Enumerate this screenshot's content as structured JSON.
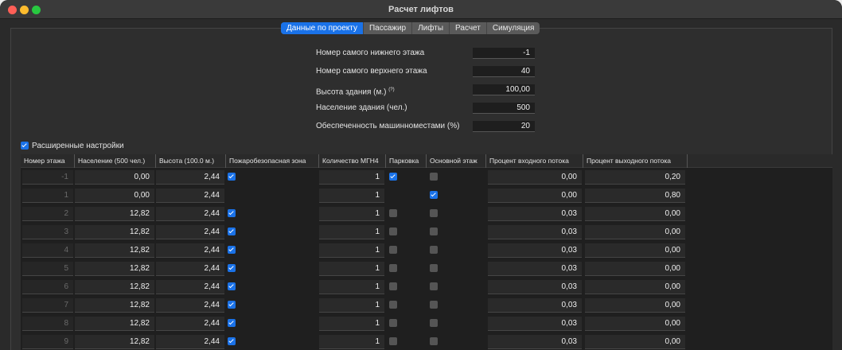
{
  "window": {
    "title": "Расчет лифтов"
  },
  "tabs": [
    {
      "label": "Данные по проекту",
      "active": true
    },
    {
      "label": "Пассажир",
      "active": false
    },
    {
      "label": "Лифты",
      "active": false
    },
    {
      "label": "Расчет",
      "active": false
    },
    {
      "label": "Симуляция",
      "active": false
    }
  ],
  "form": [
    {
      "label": "Номер самого нижнего этажа",
      "value": "-1"
    },
    {
      "label": "Номер самого верхнего этажа",
      "value": "40"
    },
    {
      "label": "Высота здания (м.)",
      "note": "(?)",
      "value": "100,00"
    },
    {
      "label": "Население здания (чел.)",
      "value": "500"
    },
    {
      "label": "Обеспеченность машинноместами (%)",
      "value": "20"
    }
  ],
  "advanced": {
    "label": "Расширенные настройки",
    "checked": true
  },
  "table": {
    "columns": [
      "Номер этажа",
      "Население (500 чел.)",
      "Высота (100.0 м.)",
      "Пожаробезопасная зона",
      "Количество МГН4",
      "Парковка",
      "Основной этаж",
      "Процент входного потока",
      "Процент выходного потока"
    ],
    "rows": [
      {
        "floor": "-1",
        "population": "0,00",
        "height": "2,44",
        "fire": true,
        "mgn": "1",
        "parking": true,
        "main": false,
        "in": "0,00",
        "out": "0,20"
      },
      {
        "floor": "1",
        "population": "0,00",
        "height": "2,44",
        "fire": null,
        "mgn": "1",
        "parking": null,
        "main": true,
        "in": "0,00",
        "out": "0,80"
      },
      {
        "floor": "2",
        "population": "12,82",
        "height": "2,44",
        "fire": true,
        "mgn": "1",
        "parking": false,
        "main": false,
        "in": "0,03",
        "out": "0,00"
      },
      {
        "floor": "3",
        "population": "12,82",
        "height": "2,44",
        "fire": true,
        "mgn": "1",
        "parking": false,
        "main": false,
        "in": "0,03",
        "out": "0,00"
      },
      {
        "floor": "4",
        "population": "12,82",
        "height": "2,44",
        "fire": true,
        "mgn": "1",
        "parking": false,
        "main": false,
        "in": "0,03",
        "out": "0,00"
      },
      {
        "floor": "5",
        "population": "12,82",
        "height": "2,44",
        "fire": true,
        "mgn": "1",
        "parking": false,
        "main": false,
        "in": "0,03",
        "out": "0,00"
      },
      {
        "floor": "6",
        "population": "12,82",
        "height": "2,44",
        "fire": true,
        "mgn": "1",
        "parking": false,
        "main": false,
        "in": "0,03",
        "out": "0,00"
      },
      {
        "floor": "7",
        "population": "12,82",
        "height": "2,44",
        "fire": true,
        "mgn": "1",
        "parking": false,
        "main": false,
        "in": "0,03",
        "out": "0,00"
      },
      {
        "floor": "8",
        "population": "12,82",
        "height": "2,44",
        "fire": true,
        "mgn": "1",
        "parking": false,
        "main": false,
        "in": "0,03",
        "out": "0,00"
      },
      {
        "floor": "9",
        "population": "12,82",
        "height": "2,44",
        "fire": true,
        "mgn": "1",
        "parking": false,
        "main": false,
        "in": "0,03",
        "out": "0,00"
      }
    ]
  }
}
